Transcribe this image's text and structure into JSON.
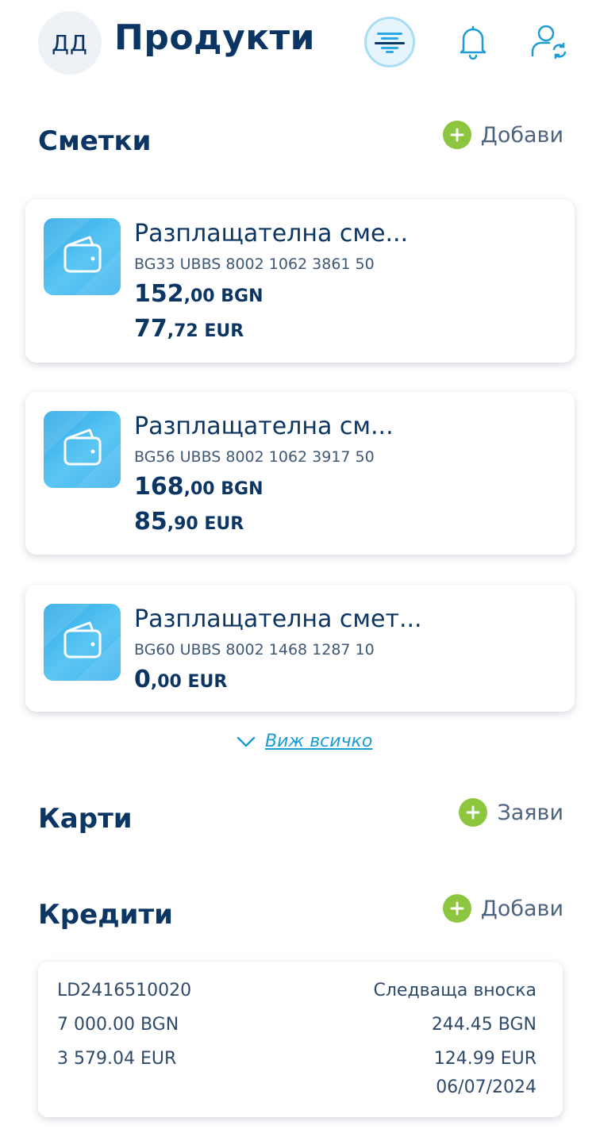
{
  "header": {
    "avatar_initials": "ДД",
    "title": "Продукти",
    "icons": [
      "bank-logo-icon",
      "bell-icon",
      "user-switch-icon"
    ]
  },
  "accounts": {
    "title": "Сметки",
    "add_label": "Добави",
    "items": [
      {
        "name": "Разплащателна сме...",
        "iban": "BG33 UBBS 8002 1062 3861 50",
        "bgn_int": "152",
        "bgn_dec": ",00 BGN",
        "eur_int": "77",
        "eur_dec": ",72 EUR"
      },
      {
        "name": "Разплащателна см...",
        "iban": "BG56 UBBS 8002 1062 3917 50",
        "bgn_int": "168",
        "bgn_dec": ",00 BGN",
        "eur_int": "85",
        "eur_dec": ",90 EUR"
      },
      {
        "name": "Разплащателна смет...",
        "iban": "BG60 UBBS 8002 1468 1287 10",
        "eur_int": "0",
        "eur_dec": ",00 EUR"
      }
    ],
    "see_all_label": "Виж всичко"
  },
  "cards": {
    "title": "Карти",
    "apply_label": "Заяви"
  },
  "credits": {
    "title": "Кредити",
    "add_label": "Добави",
    "loan": {
      "id": "LD2416510020",
      "amount_bgn": "7 000.00 BGN",
      "amount_eur": "3 579.04 EUR",
      "next_installment_label": "Следваща вноска",
      "installment_bgn": "244.45 BGN",
      "installment_eur": "124.99 EUR",
      "installment_date": "06/07/2024"
    }
  },
  "colors": {
    "primary": "#0b3563",
    "accent_blue": "#1b9bd7",
    "add_green": "#8cc63f"
  }
}
